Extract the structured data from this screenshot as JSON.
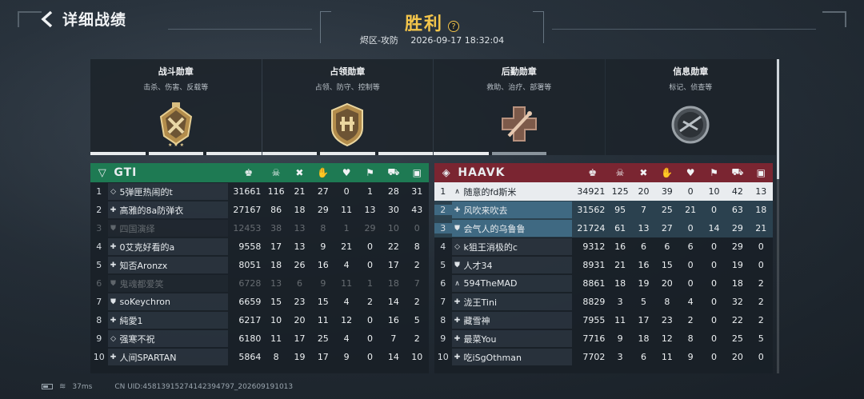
{
  "header": {
    "back_title": "详细战绩",
    "result": "胜利",
    "help": "?",
    "map": "烬区-攻防",
    "datetime": "2026-09-17 18:32:04"
  },
  "medals": [
    {
      "title": "战斗勋章",
      "desc": "击杀、伤害、反载等",
      "bars": 3,
      "filled": 3
    },
    {
      "title": "占领勋章",
      "desc": "占领、防守、控制等",
      "bars": 3,
      "filled": 3
    },
    {
      "title": "后勤勋章",
      "desc": "救助、治疗、部署等",
      "bars": 2,
      "filled": 1
    },
    {
      "title": "信息勋章",
      "desc": "标记、侦查等",
      "bars": 0,
      "filled": 0
    }
  ],
  "stat_icons": [
    "score-icon",
    "kill-skull-icon",
    "death-cross-icon",
    "assist-handshake-icon",
    "heal-heart-icon",
    "capture-flag-icon",
    "vehicle-icon",
    "supply-icon"
  ],
  "team_left": {
    "name": "GTI",
    "color": "#1e7a53",
    "players": [
      {
        "rank": "1",
        "sym": "◇",
        "name": "5弹匣热闹的t",
        "stats": [
          "31661",
          "116",
          "21",
          "27",
          "0",
          "1",
          "28",
          "31"
        ],
        "dim": false
      },
      {
        "rank": "2",
        "sym": "✚",
        "name": "高雅的8a防弹衣",
        "stats": [
          "27167",
          "86",
          "18",
          "29",
          "11",
          "13",
          "30",
          "43"
        ],
        "dim": false
      },
      {
        "rank": "3",
        "sym": "⛊",
        "name": "四国演绎",
        "stats": [
          "12453",
          "38",
          "13",
          "8",
          "1",
          "29",
          "10",
          "0"
        ],
        "dim": true
      },
      {
        "rank": "4",
        "sym": "✚",
        "name": "0艾克好看的a",
        "stats": [
          "9558",
          "17",
          "13",
          "9",
          "21",
          "0",
          "22",
          "8"
        ],
        "dim": false
      },
      {
        "rank": "5",
        "sym": "✚",
        "name": "知否Aronzx",
        "stats": [
          "8051",
          "18",
          "26",
          "16",
          "4",
          "0",
          "17",
          "2"
        ],
        "dim": false
      },
      {
        "rank": "6",
        "sym": "⛊",
        "name": "鬼魂都爱笑",
        "stats": [
          "6728",
          "13",
          "6",
          "9",
          "11",
          "1",
          "18",
          "7"
        ],
        "dim": true
      },
      {
        "rank": "7",
        "sym": "⛊",
        "name": "soKeychron",
        "stats": [
          "6659",
          "15",
          "23",
          "15",
          "4",
          "2",
          "14",
          "2"
        ],
        "dim": false
      },
      {
        "rank": "8",
        "sym": "✚",
        "name": "純愛1",
        "stats": [
          "6217",
          "10",
          "20",
          "11",
          "12",
          "0",
          "16",
          "5"
        ],
        "dim": false
      },
      {
        "rank": "9",
        "sym": "◇",
        "name": "强寒不祝",
        "stats": [
          "6180",
          "11",
          "17",
          "25",
          "4",
          "0",
          "7",
          "2"
        ],
        "dim": false
      },
      {
        "rank": "10",
        "sym": "✚",
        "name": "人间SPARTAN",
        "stats": [
          "5864",
          "8",
          "19",
          "17",
          "9",
          "0",
          "14",
          "10"
        ],
        "dim": false
      }
    ]
  },
  "team_right": {
    "name": "HAAVK",
    "color": "#7a2531",
    "players": [
      {
        "rank": "1",
        "sym": "∧",
        "name": "随意的fd斯米",
        "stats": [
          "34921",
          "125",
          "20",
          "39",
          "0",
          "10",
          "42",
          "13"
        ],
        "style": "self"
      },
      {
        "rank": "2",
        "sym": "✚",
        "name": "风吹来吹去",
        "stats": [
          "31562",
          "95",
          "7",
          "25",
          "21",
          "0",
          "63",
          "18"
        ],
        "style": "squad"
      },
      {
        "rank": "3",
        "sym": "⛊",
        "name": "会气人的乌鲁鲁",
        "stats": [
          "21724",
          "61",
          "13",
          "27",
          "0",
          "14",
          "29",
          "21"
        ],
        "style": "squad"
      },
      {
        "rank": "4",
        "sym": "◇",
        "name": "k狙王消极的c",
        "stats": [
          "9312",
          "16",
          "6",
          "6",
          "6",
          "0",
          "29",
          "0"
        ],
        "style": ""
      },
      {
        "rank": "5",
        "sym": "⛊",
        "name": "人才34",
        "stats": [
          "8931",
          "21",
          "16",
          "15",
          "0",
          "0",
          "19",
          "0"
        ],
        "style": ""
      },
      {
        "rank": "6",
        "sym": "∧",
        "name": "594TheMAD",
        "stats": [
          "8861",
          "18",
          "19",
          "20",
          "0",
          "0",
          "18",
          "2"
        ],
        "style": ""
      },
      {
        "rank": "7",
        "sym": "✚",
        "name": "泷王Tini",
        "stats": [
          "8829",
          "3",
          "5",
          "8",
          "4",
          "0",
          "32",
          "2"
        ],
        "style": ""
      },
      {
        "rank": "8",
        "sym": "✚",
        "name": "藏雪神",
        "stats": [
          "7955",
          "11",
          "17",
          "23",
          "2",
          "0",
          "22",
          "2"
        ],
        "style": ""
      },
      {
        "rank": "9",
        "sym": "✚",
        "name": "最菜You",
        "stats": [
          "7716",
          "9",
          "18",
          "12",
          "8",
          "0",
          "25",
          "5"
        ],
        "style": ""
      },
      {
        "rank": "10",
        "sym": "✚",
        "name": "吃iSgOthman",
        "stats": [
          "7702",
          "3",
          "6",
          "11",
          "9",
          "0",
          "20",
          "0"
        ],
        "style": ""
      }
    ]
  },
  "footer": {
    "ping": "37ms",
    "uid": "CN UID:4581391527414239479​7_202609191013"
  }
}
